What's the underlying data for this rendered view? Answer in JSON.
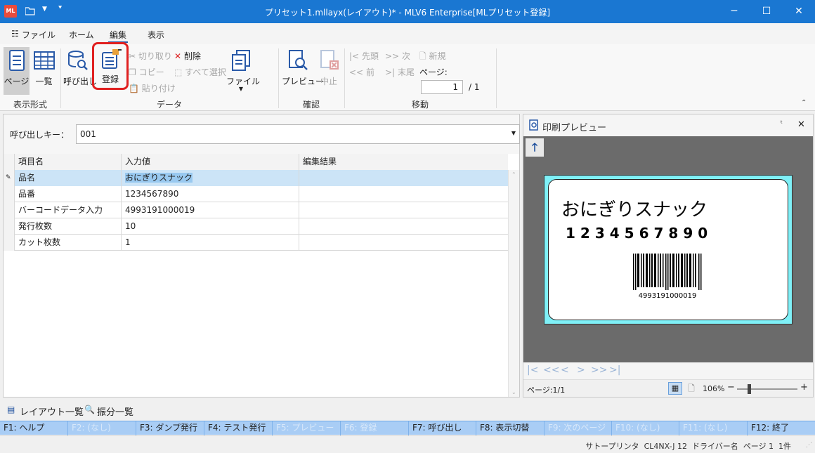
{
  "window": {
    "title": "プリセット1.mllayx(レイアウト)* - MLV6 Enterprise[MLプリセット登録]",
    "app_icon": "ML"
  },
  "menu": {
    "items": [
      "ファイル",
      "ホーム",
      "編集",
      "表示"
    ]
  },
  "ribbon": {
    "display": {
      "page": "ページ",
      "list": "一覧",
      "group": "表示形式"
    },
    "data": {
      "call": "呼び出し",
      "register": "登録",
      "cut": "切り取り",
      "copy": "コピー",
      "paste": "貼り付け",
      "delete": "削除",
      "select_all": "すべて選択",
      "file": "ファイル",
      "group": "データ"
    },
    "confirm": {
      "preview": "プレビュー",
      "cancel": "中止",
      "group": "確認"
    },
    "move": {
      "first": "先頭",
      "next": "次",
      "prev": "前",
      "last": "末尾",
      "new": "新規",
      "page_label": "ページ:",
      "page_value": "1",
      "page_total": "/ 1",
      "group": "移動"
    }
  },
  "call_key": {
    "label": "呼び出しキー：",
    "value": "001"
  },
  "grid": {
    "headers": [
      "項目名",
      "入力値",
      "編集結果"
    ],
    "rows": [
      {
        "name": "品名",
        "value": "おにぎりスナック",
        "result": ""
      },
      {
        "name": "品番",
        "value": "1234567890",
        "result": ""
      },
      {
        "name": "バーコードデータ入力",
        "value": "4993191000019",
        "result": ""
      },
      {
        "name": "発行枚数",
        "value": "10",
        "result": ""
      },
      {
        "name": "カット枚数",
        "value": "1",
        "result": ""
      }
    ]
  },
  "preview": {
    "title": "印刷プレビュー",
    "label_name": "おにぎりスナック",
    "label_code": "1234567890",
    "barcode_text": "4993191000019",
    "page_info": "ページ:1/1",
    "zoom": "106%"
  },
  "bottom_tabs": {
    "layout_list": "レイアウト一覧",
    "distribute_list": "振分一覧"
  },
  "fkeys": [
    {
      "label": "F1: ヘルプ",
      "enabled": true
    },
    {
      "label": "F2: (なし)",
      "enabled": false
    },
    {
      "label": "F3: ダンプ発行",
      "enabled": true
    },
    {
      "label": "F4: テスト発行",
      "enabled": true
    },
    {
      "label": "F5: プレビュー",
      "enabled": false
    },
    {
      "label": "F6: 登録",
      "enabled": false
    },
    {
      "label": "F7: 呼び出し",
      "enabled": true
    },
    {
      "label": "F8: 表示切替",
      "enabled": true
    },
    {
      "label": "F9: 次のページ",
      "enabled": false
    },
    {
      "label": "F10: (なし)",
      "enabled": false
    },
    {
      "label": "F11: (なし)",
      "enabled": false
    },
    {
      "label": "F12: 終了",
      "enabled": true
    }
  ],
  "status": {
    "text": "サトープリンタ  CL4NX-J 12  ドライバー名  ページ 1  1件"
  },
  "colors": {
    "titlebar": "#1a77d2",
    "accent": "#2a5aa8",
    "highlight": "#cce4f7",
    "fkey_bar": "#a9cdf5",
    "label_bg": "#7ff0f7"
  }
}
